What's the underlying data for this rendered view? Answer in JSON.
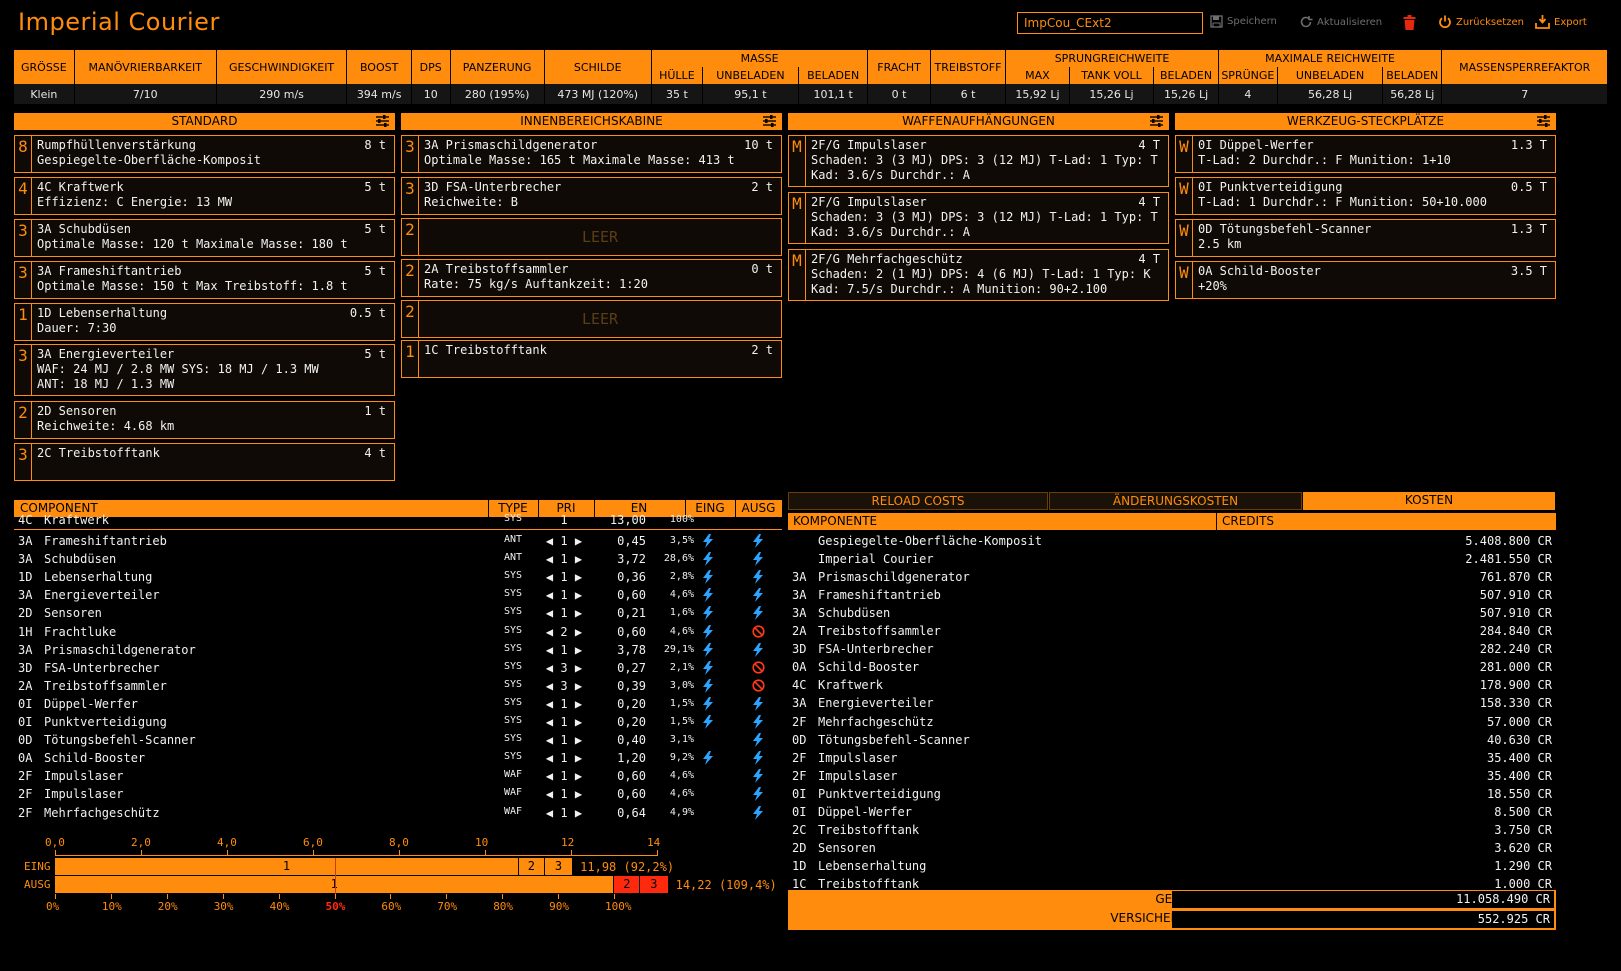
{
  "header": {
    "title": "Imperial Courier",
    "build_name": "ImpCou_CExt2",
    "save_label": "Speichern",
    "reload_label": "Aktualisieren",
    "reset_label": "Zurücksetzen",
    "export_label": "Export"
  },
  "summary": {
    "h": {
      "groesse": "GRÖSSE",
      "manoever": "MANÖVRIERBARKEIT",
      "geschw": "GESCHWINDIGKEIT",
      "boost": "BOOST",
      "dps": "DPS",
      "panzerung": "PANZERUNG",
      "schilde": "SCHILDE",
      "masse": "MASSE",
      "huelle": "HÜLLE",
      "unbeladen": "UNBELADEN",
      "beladen": "BELADEN",
      "fracht": "FRACHT",
      "treibstoff": "TREIBSTOFF",
      "sprung": "SPRUNGREICHWEITE",
      "max": "MAX",
      "tankvoll": "TANK VOLL",
      "sbeladen": "BELADEN",
      "maxreich": "MAXIMALE REICHWEITE",
      "spruenge": "SPRÜNGE",
      "munbeladen": "UNBELADEN",
      "mbeladen": "BELADEN",
      "massensperre": "MASSENSPERREFAKTOR"
    },
    "v": {
      "groesse": "Klein",
      "manoever": "7/10",
      "geschw": "290 m/s",
      "boost": "394 m/s",
      "dps": "10",
      "panzerung": "280 (195%)",
      "schilde": "473 MJ (120%)",
      "huelle": "35 t",
      "unbeladen": "95,1 t",
      "beladen": "101,1 t",
      "fracht": "0 t",
      "treibstoff": "6 t",
      "max": "15,92 Lj",
      "tankvoll": "15,26 Lj",
      "sbeladen": "15,26 Lj",
      "spruenge": "4",
      "munbeladen": "56,28 Lj",
      "mbeladen": "56,28 Lj",
      "massensperre": "7"
    }
  },
  "panels": {
    "standard": {
      "title": "STANDARD",
      "slots": [
        {
          "size": "8",
          "name": "Rumpfhüllenverstärkung",
          "mass": "8 t",
          "l1": "Gespiegelte-Oberfläche-Komposit",
          "l2": ""
        },
        {
          "size": "4",
          "name": "4C Kraftwerk",
          "mass": "5 t",
          "l1": "Effizienz: C  Energie: 13 MW",
          "l2": ""
        },
        {
          "size": "3",
          "name": "3A Schubdüsen",
          "mass": "5 t",
          "l1": "Optimale Masse: 120 t  Maximale Masse: 180 t",
          "l2": ""
        },
        {
          "size": "3",
          "name": "3A Frameshiftantrieb",
          "mass": "5 t",
          "l1": "Optimale Masse: 150 t  Max Treibstoff: 1.8 t",
          "l2": ""
        },
        {
          "size": "1",
          "name": "1D Lebenserhaltung",
          "mass": "0.5 t",
          "l1": "Dauer: 7:30",
          "l2": ""
        },
        {
          "size": "3",
          "name": "3A Energieverteiler",
          "mass": "5 t",
          "l1": "WAF: 24 MJ / 2.8 MW  SYS: 18 MJ / 1.3 MW",
          "l2": "ANT: 18 MJ / 1.3 MW"
        },
        {
          "size": "2",
          "name": "2D Sensoren",
          "mass": "1 t",
          "l1": "Reichweite: 4.68 km",
          "l2": ""
        },
        {
          "size": "3",
          "name": "2C Treibstofftank",
          "mass": "4 t",
          "l1": "",
          "l2": ""
        }
      ]
    },
    "internal": {
      "title": "INNENBEREICHSKABINE",
      "slots": [
        {
          "size": "3",
          "name": "3A Prismaschildgenerator",
          "mass": "10 t",
          "l1": "Optimale Masse: 165 t  Maximale Masse: 413 t",
          "l2": ""
        },
        {
          "size": "3",
          "name": "3D FSA-Unterbrecher",
          "mass": "2 t",
          "l1": "Reichweite: B",
          "l2": ""
        },
        {
          "size": "2",
          "name": "",
          "mass": "",
          "l1": "",
          "l2": "",
          "empty": "LEER"
        },
        {
          "size": "2",
          "name": "2A Treibstoffsammler",
          "mass": "0 t",
          "l1": "Rate: 75 kg/s  Auftankzeit: 1:20",
          "l2": ""
        },
        {
          "size": "2",
          "name": "",
          "mass": "",
          "l1": "",
          "l2": "",
          "empty": "LEER"
        },
        {
          "size": "1",
          "name": "1C Treibstofftank",
          "mass": "2 t",
          "l1": "",
          "l2": ""
        }
      ]
    },
    "hardpoints": {
      "title": "WAFFENAUFHÄNGUNGEN",
      "slots": [
        {
          "size": "M",
          "name": "2F/G Impulslaser",
          "mass": "4 T",
          "l1": "Schaden: 3 (3 MJ)  DPS: 3 (12 MJ)  T-Lad: 1  Typ: T",
          "l2": "Kad: 3.6/s  Durchdr.: A"
        },
        {
          "size": "M",
          "name": "2F/G Impulslaser",
          "mass": "4 T",
          "l1": "Schaden: 3 (3 MJ)  DPS: 3 (12 MJ)  T-Lad: 1  Typ: T",
          "l2": "Kad: 3.6/s  Durchdr.: A"
        },
        {
          "size": "M",
          "name": "2F/G Mehrfachgeschütz",
          "mass": "4 T",
          "l1": "Schaden: 2 (1 MJ)  DPS: 4 (6 MJ)  T-Lad: 1  Typ: K",
          "l2": "Kad: 7.5/s  Durchdr.: A  Munition: 90+2.100"
        }
      ]
    },
    "utility": {
      "title": "WERKZEUG-STECKPLÄTZE",
      "slots": [
        {
          "size": "W",
          "name": "0I Düppel-Werfer",
          "mass": "1.3 T",
          "l1": "T-Lad: 2  Durchdr.: F  Munition: 1+10",
          "l2": ""
        },
        {
          "size": "W",
          "name": "0I Punktverteidigung",
          "mass": "0.5 T",
          "l1": "T-Lad: 1  Durchdr.: F  Munition: 50+10.000",
          "l2": ""
        },
        {
          "size": "W",
          "name": "0D Tötungsbefehl-Scanner",
          "mass": "1.3 T",
          "l1": "2.5 km",
          "l2": ""
        },
        {
          "size": "W",
          "name": "0A Schild-Booster",
          "mass": "3.5 T",
          "l1": "+20%",
          "l2": ""
        }
      ]
    }
  },
  "power": {
    "headers": {
      "component": "COMPONENT",
      "type": "TYPE",
      "pri": "PRI",
      "en": "EN",
      "eing": "EING",
      "ausg": "AUSG"
    },
    "plant": {
      "cls": "4C",
      "name": "Kraftwerk",
      "type": "SYS",
      "pri": "1",
      "en": "13,00",
      "pct": "100%"
    },
    "rows": [
      {
        "cls": "3A",
        "name": "Frameshiftantrieb",
        "type": "ANT",
        "pri": "1",
        "en": "0,45",
        "pct": "3,5%",
        "eing": "on",
        "ausg": "on"
      },
      {
        "cls": "3A",
        "name": "Schubdüsen",
        "type": "ANT",
        "pri": "1",
        "en": "3,72",
        "pct": "28,6%",
        "eing": "on",
        "ausg": "on"
      },
      {
        "cls": "1D",
        "name": "Lebenserhaltung",
        "type": "SYS",
        "pri": "1",
        "en": "0,36",
        "pct": "2,8%",
        "eing": "on",
        "ausg": "on"
      },
      {
        "cls": "3A",
        "name": "Energieverteiler",
        "type": "SYS",
        "pri": "1",
        "en": "0,60",
        "pct": "4,6%",
        "eing": "on",
        "ausg": "on"
      },
      {
        "cls": "2D",
        "name": "Sensoren",
        "type": "SYS",
        "pri": "1",
        "en": "0,21",
        "pct": "1,6%",
        "eing": "on",
        "ausg": "on"
      },
      {
        "cls": "1H",
        "name": "Frachtluke",
        "type": "SYS",
        "pri": "2",
        "en": "0,60",
        "pct": "4,6%",
        "eing": "on",
        "ausg": "off"
      },
      {
        "cls": "3A",
        "name": "Prismaschildgenerator",
        "type": "SYS",
        "pri": "1",
        "en": "3,78",
        "pct": "29,1%",
        "eing": "on",
        "ausg": "on"
      },
      {
        "cls": "3D",
        "name": "FSA-Unterbrecher",
        "type": "SYS",
        "pri": "3",
        "en": "0,27",
        "pct": "2,1%",
        "eing": "on",
        "ausg": "off"
      },
      {
        "cls": "2A",
        "name": "Treibstoffsammler",
        "type": "SYS",
        "pri": "3",
        "en": "0,39",
        "pct": "3,0%",
        "eing": "on",
        "ausg": "off"
      },
      {
        "cls": "0I",
        "name": "Düppel-Werfer",
        "type": "SYS",
        "pri": "1",
        "en": "0,20",
        "pct": "1,5%",
        "eing": "on",
        "ausg": "on"
      },
      {
        "cls": "0I",
        "name": "Punktverteidigung",
        "type": "SYS",
        "pri": "1",
        "en": "0,20",
        "pct": "1,5%",
        "eing": "on",
        "ausg": "on"
      },
      {
        "cls": "0D",
        "name": "Tötungsbefehl-Scanner",
        "type": "SYS",
        "pri": "1",
        "en": "0,40",
        "pct": "3,1%",
        "eing": "",
        "ausg": "on"
      },
      {
        "cls": "0A",
        "name": "Schild-Booster",
        "type": "SYS",
        "pri": "1",
        "en": "1,20",
        "pct": "9,2%",
        "eing": "on",
        "ausg": "on"
      },
      {
        "cls": "2F",
        "name": "Impulslaser",
        "type": "WAF",
        "pri": "1",
        "en": "0,60",
        "pct": "4,6%",
        "eing": "",
        "ausg": "on"
      },
      {
        "cls": "2F",
        "name": "Impulslaser",
        "type": "WAF",
        "pri": "1",
        "en": "0,60",
        "pct": "4,6%",
        "eing": "",
        "ausg": "on"
      },
      {
        "cls": "2F",
        "name": "Mehrfachgeschütz",
        "type": "WAF",
        "pri": "1",
        "en": "0,64",
        "pct": "4,9%",
        "eing": "",
        "ausg": "on"
      }
    ]
  },
  "power_chart": {
    "top_ticks": [
      "0,0",
      "2,0",
      "4,0",
      "6,0",
      "8,0",
      "10",
      "12",
      "14"
    ],
    "bottom_ticks": [
      "0%",
      "10%",
      "20%",
      "30%",
      "40%",
      "50%",
      "60%",
      "70%",
      "80%",
      "90%",
      "100%"
    ],
    "max_value": 14,
    "capacity": 13.0,
    "marker_value": 6.5,
    "eing": {
      "label": "EING",
      "summary": "11,98 (92,2%)",
      "segments": [
        {
          "label": "1",
          "value": 10.79,
          "color": "#ff8c0d"
        },
        {
          "label": "2",
          "value": 0.6,
          "color": "#ff8c0d"
        },
        {
          "label": "3",
          "value": 0.66,
          "color": "#ff8c0d"
        }
      ]
    },
    "ausg": {
      "label": "AUSG",
      "summary": "14,22 (109,4%)",
      "segments": [
        {
          "label": "1",
          "value": 13.01,
          "color": "#ff8c0d"
        },
        {
          "label": "2",
          "value": 0.6,
          "color": "#ff2a0d"
        },
        {
          "label": "3",
          "value": 0.66,
          "color": "#ff2a0d"
        }
      ]
    }
  },
  "costs": {
    "tabs": [
      "RELOAD COSTS",
      "ÄNDERUNGSKOSTEN",
      "KOSTEN"
    ],
    "active_tab": 2,
    "col_component": "KOMPONENTE",
    "col_credits": "CREDITS",
    "rows": [
      {
        "cls": "",
        "name": "Gespiegelte-Oberfläche-Komposit",
        "cr": "5.408.800 CR"
      },
      {
        "cls": "",
        "name": "Imperial Courier",
        "cr": "2.481.550 CR"
      },
      {
        "cls": "3A",
        "name": "Prismaschildgenerator",
        "cr": "761.870 CR"
      },
      {
        "cls": "3A",
        "name": "Frameshiftantrieb",
        "cr": "507.910 CR"
      },
      {
        "cls": "3A",
        "name": "Schubdüsen",
        "cr": "507.910 CR"
      },
      {
        "cls": "2A",
        "name": "Treibstoffsammler",
        "cr": "284.840 CR"
      },
      {
        "cls": "3D",
        "name": "FSA-Unterbrecher",
        "cr": "282.240 CR"
      },
      {
        "cls": "0A",
        "name": "Schild-Booster",
        "cr": "281.000 CR"
      },
      {
        "cls": "4C",
        "name": "Kraftwerk",
        "cr": "178.900 CR"
      },
      {
        "cls": "3A",
        "name": "Energieverteiler",
        "cr": "158.330 CR"
      },
      {
        "cls": "2F",
        "name": "Mehrfachgeschütz",
        "cr": "57.000 CR"
      },
      {
        "cls": "0D",
        "name": "Tötungsbefehl-Scanner",
        "cr": "40.630 CR"
      },
      {
        "cls": "2F",
        "name": "Impulslaser",
        "cr": "35.400 CR"
      },
      {
        "cls": "2F",
        "name": "Impulslaser",
        "cr": "35.400 CR"
      },
      {
        "cls": "0I",
        "name": "Punktverteidigung",
        "cr": "18.550 CR"
      },
      {
        "cls": "0I",
        "name": "Düppel-Werfer",
        "cr": "8.500 CR"
      },
      {
        "cls": "2C",
        "name": "Treibstofftank",
        "cr": "3.750 CR"
      },
      {
        "cls": "2D",
        "name": "Sensoren",
        "cr": "3.620 CR"
      },
      {
        "cls": "1D",
        "name": "Lebenserhaltung",
        "cr": "1.290 CR"
      },
      {
        "cls": "1C",
        "name": "Treibstofftank",
        "cr": "1.000 CR"
      }
    ],
    "total_label": "GESAMT",
    "total_value": "11.058.490 CR",
    "insurance_label": "VERSICHERUNG",
    "insurance_value": "552.925 CR"
  },
  "colors": {
    "accent": "#ff8c0d",
    "bolt": "#2ba3ff",
    "deny": "#ff3a1a",
    "over": "#ff2a0d"
  }
}
